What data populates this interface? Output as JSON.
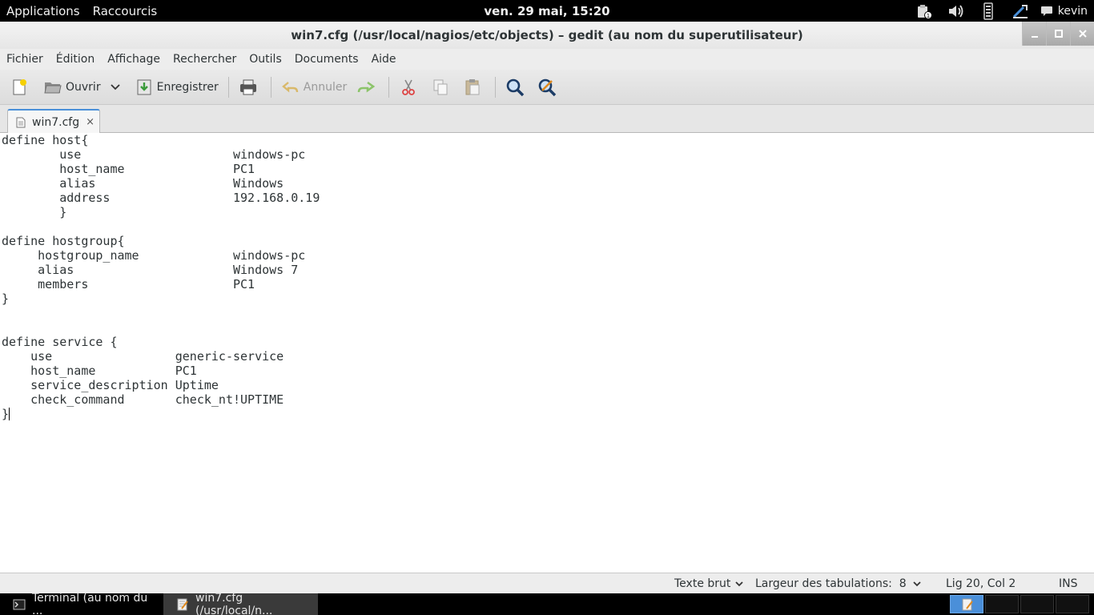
{
  "top_panel": {
    "applications": "Applications",
    "shortcuts": "Raccourcis",
    "clock": "ven. 29 mai, 15:20",
    "user": "kevin"
  },
  "window": {
    "title": "win7.cfg (/usr/local/nagios/etc/objects) – gedit (au nom du superutilisateur)"
  },
  "menu": [
    "Fichier",
    "Édition",
    "Affichage",
    "Rechercher",
    "Outils",
    "Documents",
    "Aide"
  ],
  "toolbar": {
    "open_label": "Ouvrir",
    "save_label": "Enregistrer",
    "undo_label": "Annuler"
  },
  "tab": {
    "label": "win7.cfg",
    "close": "×"
  },
  "editor": {
    "lines": [
      "define host{",
      "        use                     windows-pc",
      "        host_name               PC1",
      "        alias                   Windows",
      "        address                 192.168.0.19",
      "        }",
      "",
      "define hostgroup{",
      "     hostgroup_name             windows-pc",
      "     alias                      Windows 7",
      "     members                    PC1",
      "}",
      "",
      "",
      "define service {",
      "    use                 generic-service",
      "    host_name           PC1",
      "    service_description Uptime",
      "    check_command       check_nt!UPTIME",
      "}"
    ]
  },
  "status_bar": {
    "language": "Texte brut",
    "tab_width": "Largeur des tabulations:  8",
    "position": "Lig 20, Col 2",
    "mode": "INS"
  },
  "taskbar": {
    "task1": "Terminal (au nom du ...",
    "task2": "win7.cfg (/usr/local/n..."
  },
  "colors": {
    "panel_bg": "#000000",
    "accent": "#4a90d9"
  }
}
